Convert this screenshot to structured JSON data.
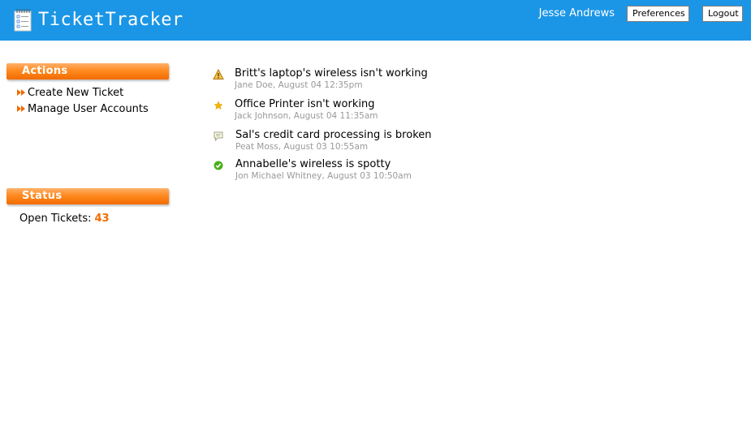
{
  "header": {
    "app_title": "TicketTracker",
    "user_name": "Jesse Andrews",
    "preferences_label": "Preferences",
    "logout_label": "Logout",
    "bg_color": "#1b96e6"
  },
  "sidebar": {
    "actions_title": "Actions",
    "actions": [
      {
        "label": "Create New Ticket",
        "icon": "double-arrow-right-icon"
      },
      {
        "label": "Manage User Accounts",
        "icon": "double-arrow-right-icon"
      }
    ],
    "status_title": "Status",
    "open_tickets_label": "Open Tickets:",
    "open_tickets_count": "43",
    "accent_color": "#f26b00"
  },
  "tickets": [
    {
      "title": "Britt's laptop's wireless isn't working",
      "meta": "Jane Doe, August 04 12:35pm",
      "icon": "warning-icon"
    },
    {
      "title": "Office Printer isn't working",
      "meta": "Jack Johnson, August 04 11:35am",
      "icon": "star-icon"
    },
    {
      "title": "Sal's credit card processing is broken",
      "meta": "Peat Moss, August 03 10:55am",
      "icon": "comment-icon"
    },
    {
      "title": "Annabelle's wireless is spotty",
      "meta": "Jon Michael Whitney, August 03 10:50am",
      "icon": "check-icon"
    }
  ]
}
